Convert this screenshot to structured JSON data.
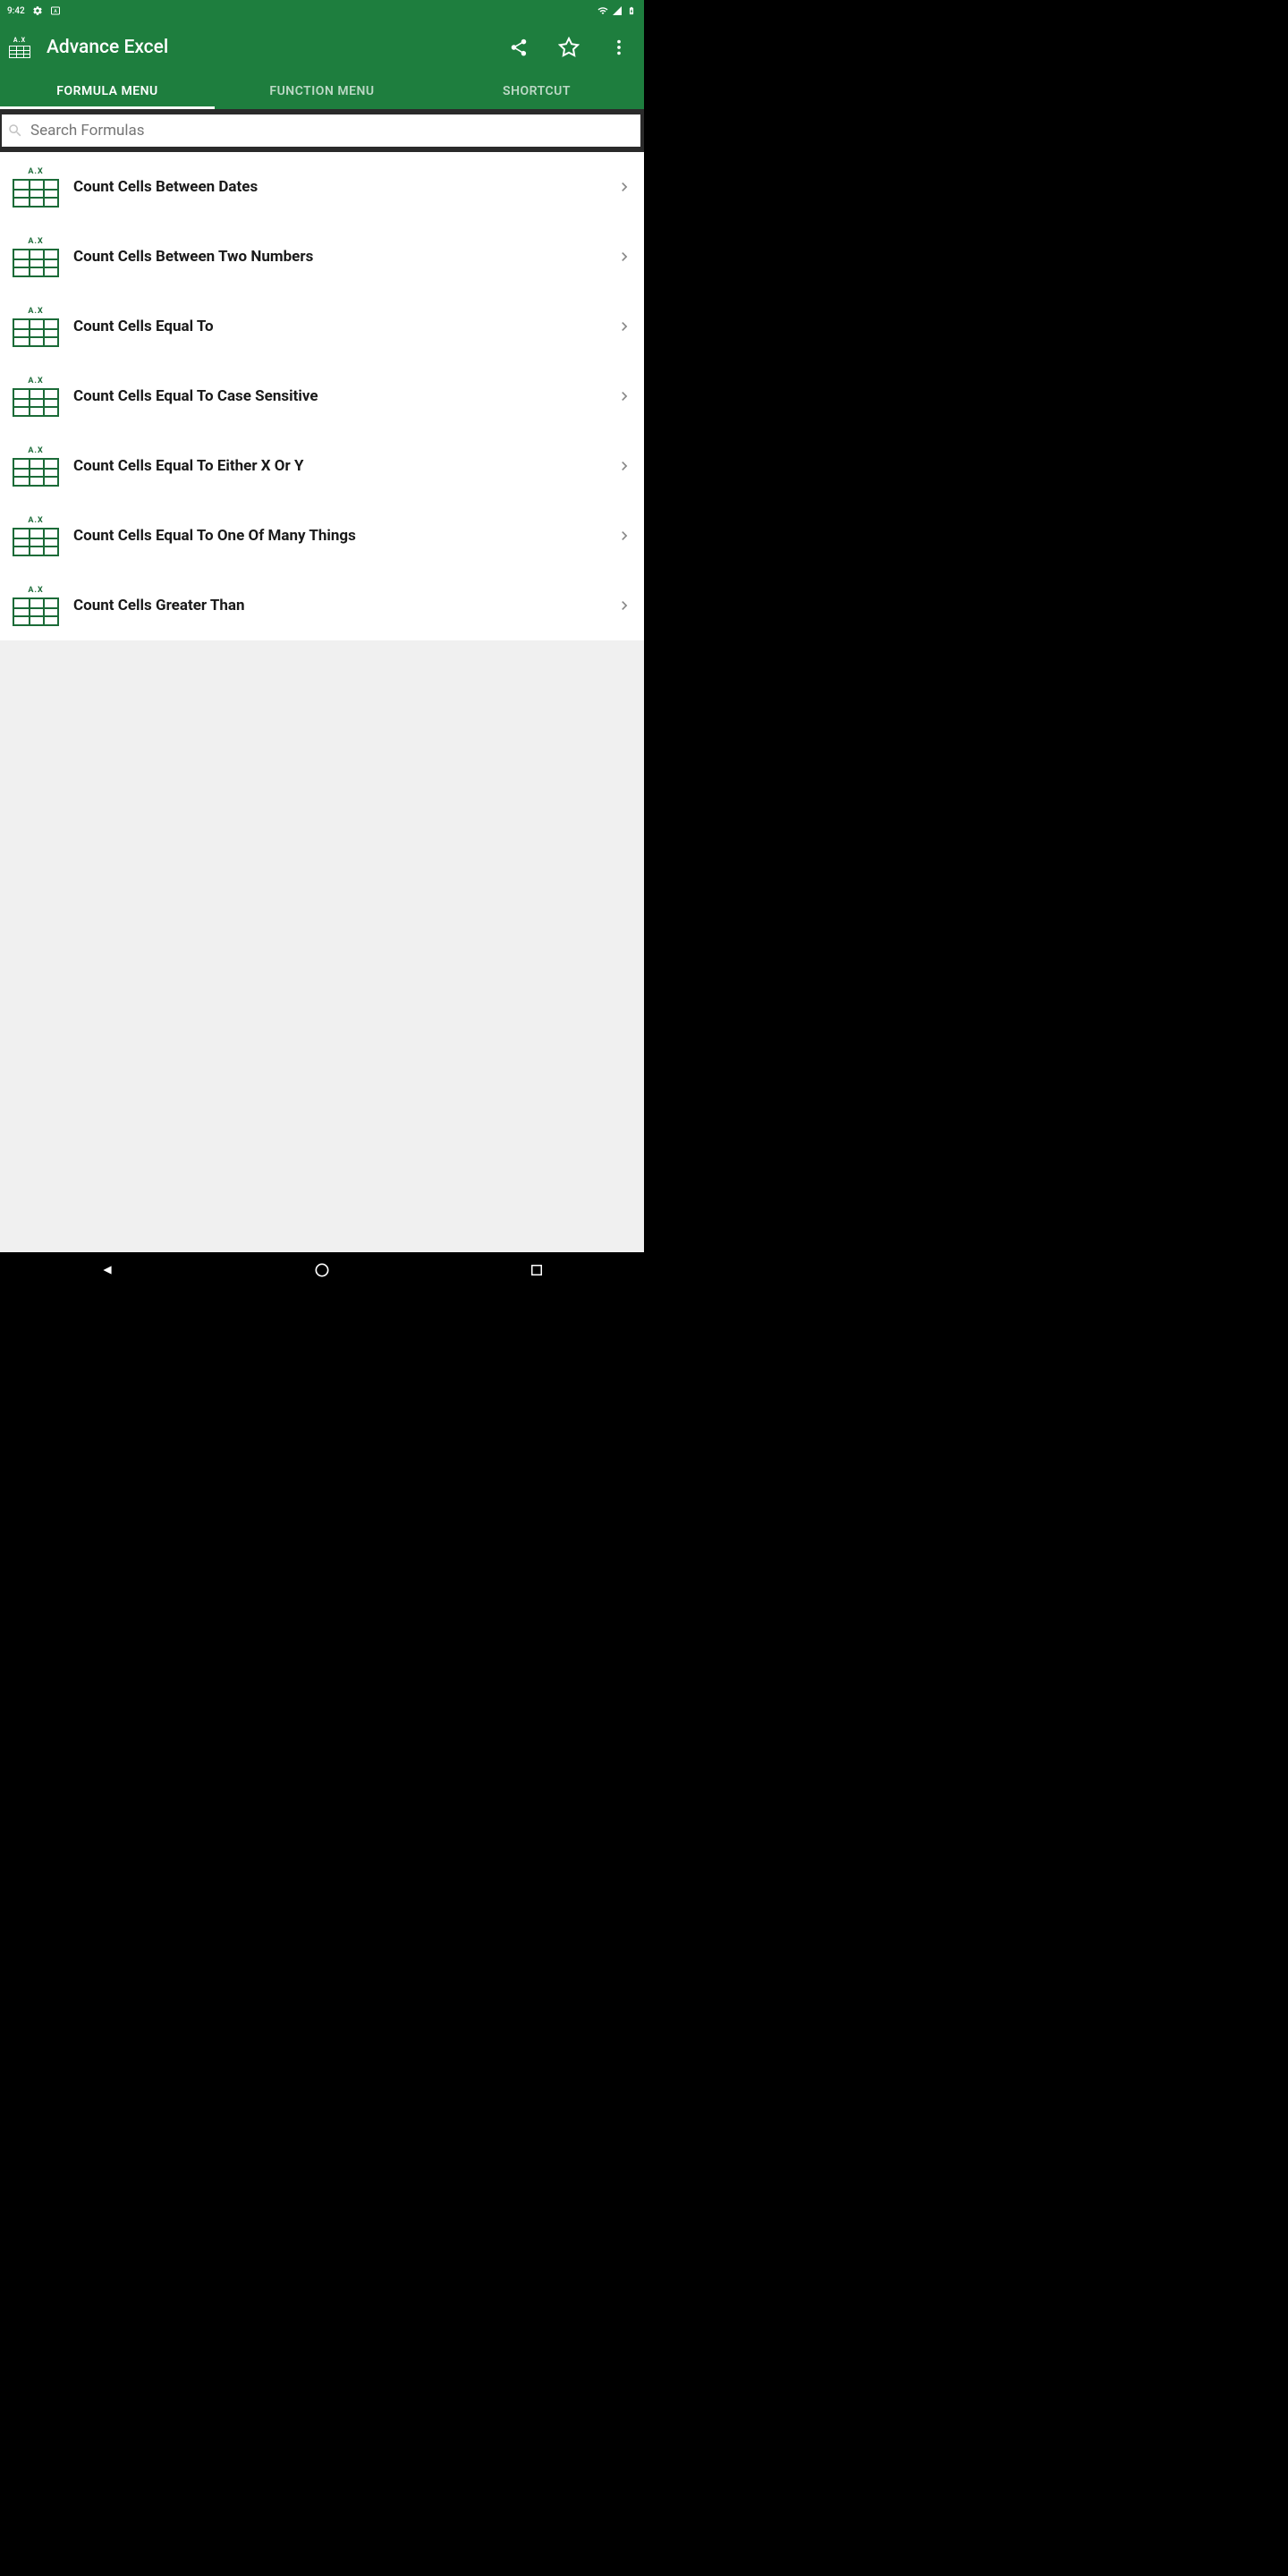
{
  "status": {
    "time": "9:42"
  },
  "header": {
    "title": "Advance Excel"
  },
  "tabs": [
    {
      "label": "FORMULA MENU",
      "active": true
    },
    {
      "label": "FUNCTION MENU",
      "active": false
    },
    {
      "label": "SHORTCUT",
      "active": false
    }
  ],
  "search": {
    "placeholder": "Search Formulas"
  },
  "formulas": [
    {
      "title": "Count Cells Between Dates"
    },
    {
      "title": "Count Cells Between Two Numbers"
    },
    {
      "title": "Count Cells Equal To"
    },
    {
      "title": "Count Cells Equal To Case Sensitive"
    },
    {
      "title": "Count Cells Equal To Either X Or Y"
    },
    {
      "title": "Count Cells Equal To One Of Many Things"
    },
    {
      "title": "Count Cells Greater Than"
    }
  ]
}
